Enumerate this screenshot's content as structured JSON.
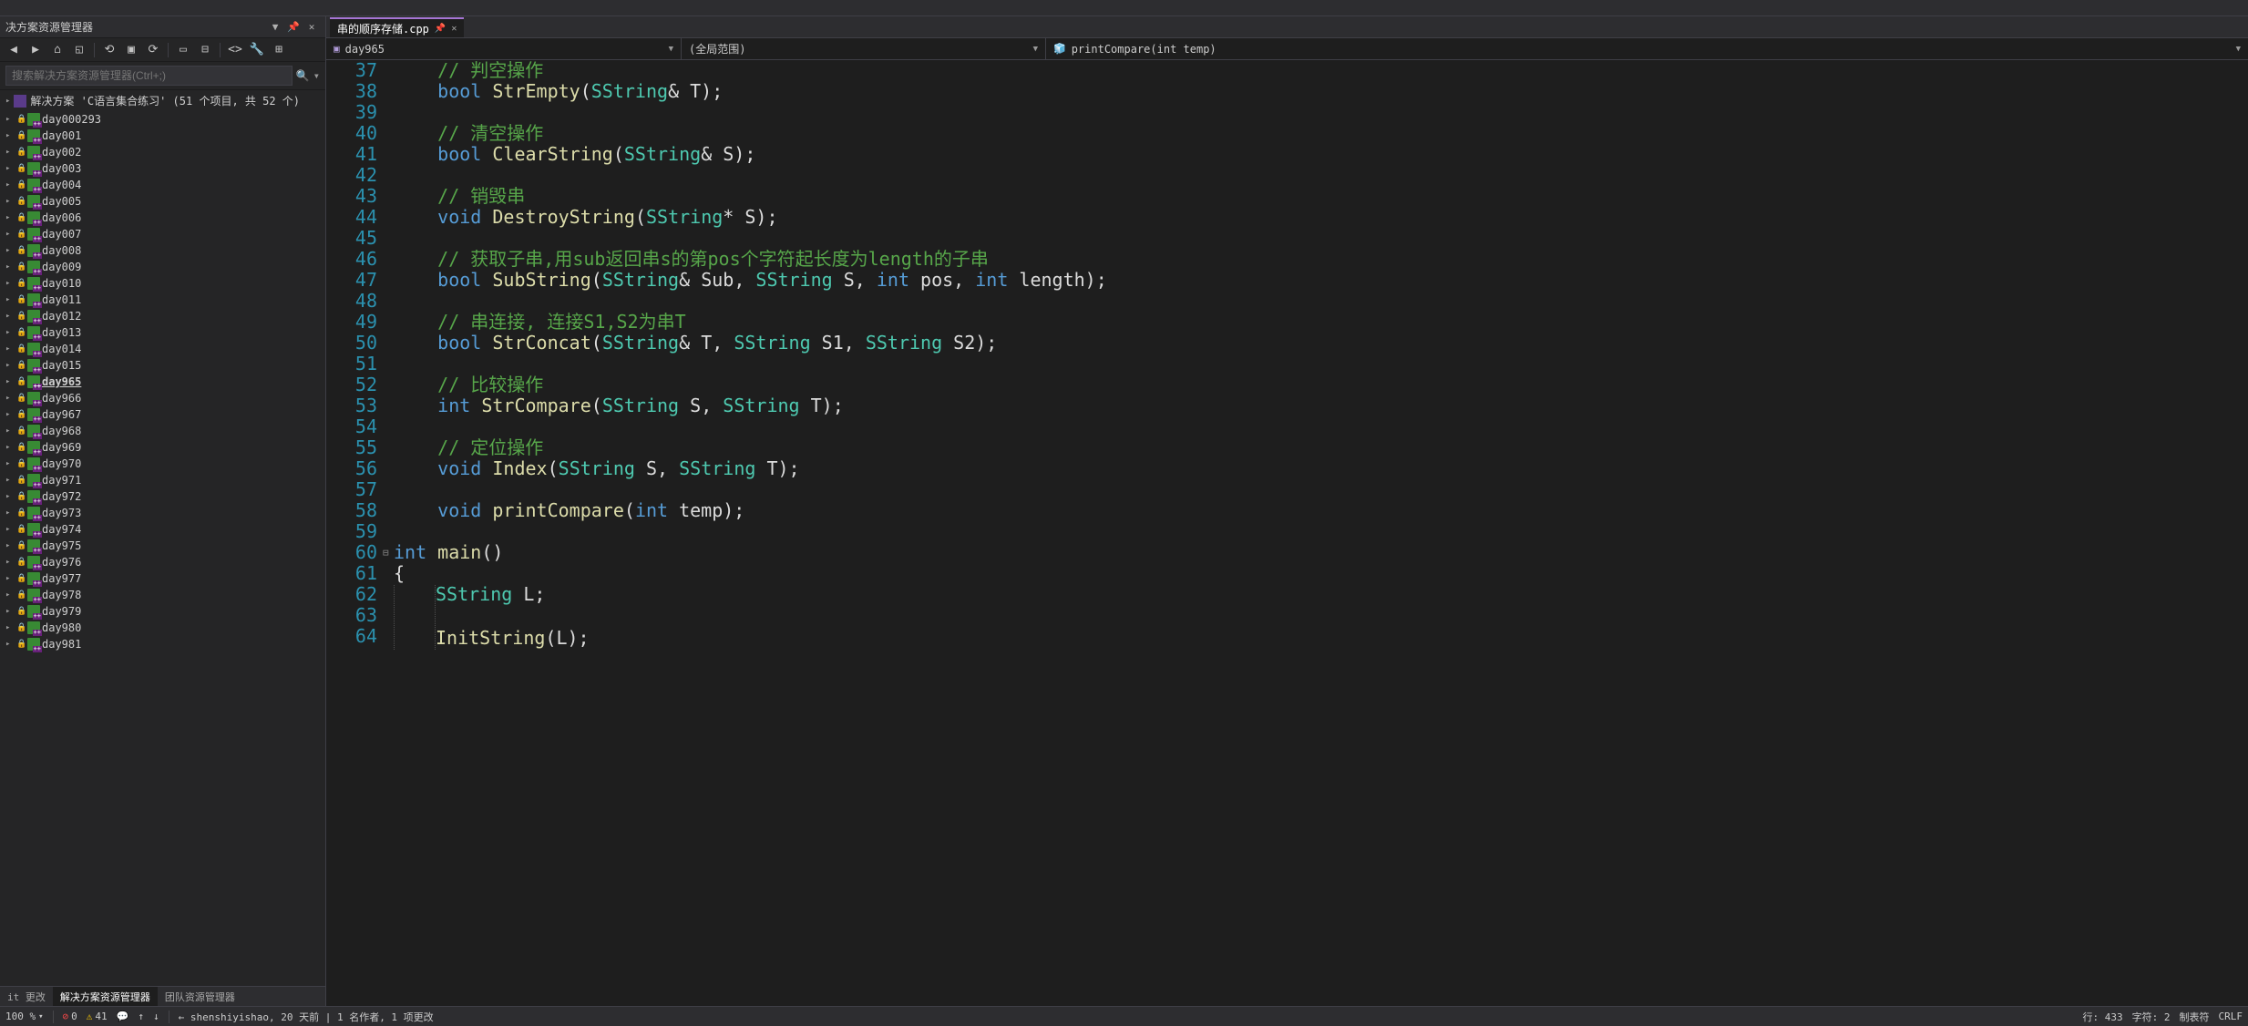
{
  "sidebar": {
    "title": "决方案资源管理器",
    "search_placeholder": "搜索解决方案资源管理器(Ctrl+;)",
    "solution_label": "解决方案 'C语言集合练习' (51 个项目, 共 52 个)",
    "items": [
      {
        "label": "day000293"
      },
      {
        "label": "day001"
      },
      {
        "label": "day002"
      },
      {
        "label": "day003"
      },
      {
        "label": "day004"
      },
      {
        "label": "day005"
      },
      {
        "label": "day006"
      },
      {
        "label": "day007"
      },
      {
        "label": "day008"
      },
      {
        "label": "day009"
      },
      {
        "label": "day010"
      },
      {
        "label": "day011"
      },
      {
        "label": "day012"
      },
      {
        "label": "day013"
      },
      {
        "label": "day014"
      },
      {
        "label": "day015"
      },
      {
        "label": "day965",
        "active": true
      },
      {
        "label": "day966"
      },
      {
        "label": "day967"
      },
      {
        "label": "day968"
      },
      {
        "label": "day969"
      },
      {
        "label": "day970"
      },
      {
        "label": "day971"
      },
      {
        "label": "day972"
      },
      {
        "label": "day973"
      },
      {
        "label": "day974"
      },
      {
        "label": "day975"
      },
      {
        "label": "day976"
      },
      {
        "label": "day977"
      },
      {
        "label": "day978"
      },
      {
        "label": "day979"
      },
      {
        "label": "day980"
      },
      {
        "label": "day981"
      }
    ],
    "bottom_tabs": [
      "it 更改",
      "解决方案资源管理器",
      "团队资源管理器"
    ],
    "active_bottom_tab": 1
  },
  "editor": {
    "tab_name": "串的顺序存储.cpp",
    "breadcrumb": {
      "project": "day965",
      "scope": "(全局范围)",
      "member": "printCompare(int temp)"
    },
    "line_start": 37,
    "line_end": 64,
    "code_lines": [
      {
        "n": 37,
        "tokens": [
          [
            "    ",
            "p"
          ],
          [
            "// 判空操作",
            "c"
          ]
        ]
      },
      {
        "n": 38,
        "tokens": [
          [
            "    ",
            "p"
          ],
          [
            "bool ",
            "t"
          ],
          [
            "StrEmpty",
            "f"
          ],
          [
            "(",
            "p"
          ],
          [
            "SString",
            "cl"
          ],
          [
            "& T);",
            "p"
          ]
        ]
      },
      {
        "n": 39,
        "tokens": []
      },
      {
        "n": 40,
        "tokens": [
          [
            "    ",
            "p"
          ],
          [
            "// 清空操作",
            "c"
          ]
        ]
      },
      {
        "n": 41,
        "tokens": [
          [
            "    ",
            "p"
          ],
          [
            "bool ",
            "t"
          ],
          [
            "ClearString",
            "f"
          ],
          [
            "(",
            "p"
          ],
          [
            "SString",
            "cl"
          ],
          [
            "& S);",
            "p"
          ]
        ]
      },
      {
        "n": 42,
        "tokens": []
      },
      {
        "n": 43,
        "tokens": [
          [
            "    ",
            "p"
          ],
          [
            "// 销毁串",
            "c"
          ]
        ]
      },
      {
        "n": 44,
        "tokens": [
          [
            "    ",
            "p"
          ],
          [
            "void ",
            "t"
          ],
          [
            "DestroyString",
            "f"
          ],
          [
            "(",
            "p"
          ],
          [
            "SString",
            "cl"
          ],
          [
            "* S);",
            "p"
          ]
        ]
      },
      {
        "n": 45,
        "tokens": []
      },
      {
        "n": 46,
        "tokens": [
          [
            "    ",
            "p"
          ],
          [
            "// 获取子串,用sub返回串s的第pos个字符起长度为length的子串",
            "c"
          ]
        ]
      },
      {
        "n": 47,
        "tokens": [
          [
            "    ",
            "p"
          ],
          [
            "bool ",
            "t"
          ],
          [
            "SubString",
            "f"
          ],
          [
            "(",
            "p"
          ],
          [
            "SString",
            "cl"
          ],
          [
            "& Sub, ",
            "p"
          ],
          [
            "SString",
            "cl"
          ],
          [
            " S, ",
            "p"
          ],
          [
            "int",
            "t"
          ],
          [
            " pos, ",
            "p"
          ],
          [
            "int",
            "t"
          ],
          [
            " length);",
            "p"
          ]
        ]
      },
      {
        "n": 48,
        "tokens": []
      },
      {
        "n": 49,
        "tokens": [
          [
            "    ",
            "p"
          ],
          [
            "// 串连接, 连接S1,S2为串T",
            "c"
          ]
        ]
      },
      {
        "n": 50,
        "tokens": [
          [
            "    ",
            "p"
          ],
          [
            "bool ",
            "t"
          ],
          [
            "StrConcat",
            "f"
          ],
          [
            "(",
            "p"
          ],
          [
            "SString",
            "cl"
          ],
          [
            "& T, ",
            "p"
          ],
          [
            "SString",
            "cl"
          ],
          [
            " S1, ",
            "p"
          ],
          [
            "SString",
            "cl"
          ],
          [
            " S2);",
            "p"
          ]
        ]
      },
      {
        "n": 51,
        "tokens": []
      },
      {
        "n": 52,
        "tokens": [
          [
            "    ",
            "p"
          ],
          [
            "// 比较操作",
            "c"
          ]
        ]
      },
      {
        "n": 53,
        "tokens": [
          [
            "    ",
            "p"
          ],
          [
            "int ",
            "t"
          ],
          [
            "StrCompare",
            "f"
          ],
          [
            "(",
            "p"
          ],
          [
            "SString",
            "cl"
          ],
          [
            " S, ",
            "p"
          ],
          [
            "SString",
            "cl"
          ],
          [
            " T);",
            "p"
          ]
        ]
      },
      {
        "n": 54,
        "tokens": []
      },
      {
        "n": 55,
        "tokens": [
          [
            "    ",
            "p"
          ],
          [
            "// 定位操作",
            "c"
          ]
        ]
      },
      {
        "n": 56,
        "tokens": [
          [
            "    ",
            "p"
          ],
          [
            "void ",
            "t"
          ],
          [
            "Index",
            "f"
          ],
          [
            "(",
            "p"
          ],
          [
            "SString",
            "cl"
          ],
          [
            " S, ",
            "p"
          ],
          [
            "SString",
            "cl"
          ],
          [
            " T);",
            "p"
          ]
        ]
      },
      {
        "n": 57,
        "tokens": []
      },
      {
        "n": 58,
        "tokens": [
          [
            "    ",
            "p"
          ],
          [
            "void ",
            "t"
          ],
          [
            "printCompare",
            "f"
          ],
          [
            "(",
            "p"
          ],
          [
            "int",
            "t"
          ],
          [
            " temp);",
            "p"
          ]
        ]
      },
      {
        "n": 59,
        "tokens": []
      },
      {
        "n": 60,
        "fold": true,
        "tokens": [
          [
            "int ",
            "t"
          ],
          [
            "main",
            "f"
          ],
          [
            "()",
            "p"
          ]
        ]
      },
      {
        "n": 61,
        "tokens": [
          [
            "{",
            "p"
          ]
        ]
      },
      {
        "n": 62,
        "guide": true,
        "tokens": [
          [
            "SString",
            "cl"
          ],
          [
            " L;",
            "p"
          ]
        ]
      },
      {
        "n": 63,
        "guide": true,
        "tokens": []
      },
      {
        "n": 64,
        "guide": true,
        "tokens": [
          [
            "InitString",
            "f"
          ],
          [
            "(L);",
            "p"
          ]
        ]
      }
    ]
  },
  "statusbar": {
    "zoom": "100 %",
    "errors": "0",
    "warnings": "41",
    "msg_count": 0,
    "blame": "← shenshiyishao, 20 天前 | 1 名作者, 1 项更改",
    "line_label": "行: 433",
    "char_label": "字符: 2",
    "tab_label": "制表符",
    "eol": "CRLF"
  }
}
